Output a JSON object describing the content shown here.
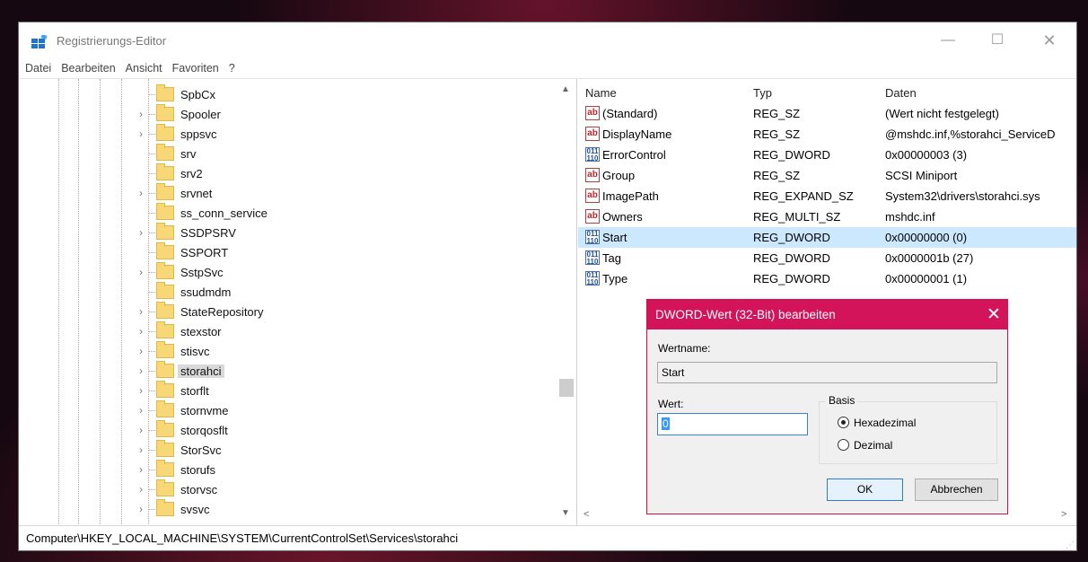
{
  "window": {
    "title": "Registrierungs-Editor",
    "minimize": "—",
    "maximize": "☐",
    "close": "✕"
  },
  "menu": [
    "Datei",
    "Bearbeiten",
    "Ansicht",
    "Favoriten",
    "?"
  ],
  "tree": {
    "items": [
      {
        "label": "SpbCx",
        "expandable": false
      },
      {
        "label": "Spooler",
        "expandable": true
      },
      {
        "label": "sppsvc",
        "expandable": true
      },
      {
        "label": "srv",
        "expandable": false
      },
      {
        "label": "srv2",
        "expandable": false
      },
      {
        "label": "srvnet",
        "expandable": true
      },
      {
        "label": "ss_conn_service",
        "expandable": false
      },
      {
        "label": "SSDPSRV",
        "expandable": true
      },
      {
        "label": "SSPORT",
        "expandable": false
      },
      {
        "label": "SstpSvc",
        "expandable": true
      },
      {
        "label": "ssudmdm",
        "expandable": false
      },
      {
        "label": "StateRepository",
        "expandable": true
      },
      {
        "label": "stexstor",
        "expandable": true
      },
      {
        "label": "stisvc",
        "expandable": true
      },
      {
        "label": "storahci",
        "expandable": true,
        "selected": true
      },
      {
        "label": "storflt",
        "expandable": true
      },
      {
        "label": "stornvme",
        "expandable": true
      },
      {
        "label": "storqosflt",
        "expandable": true
      },
      {
        "label": "StorSvc",
        "expandable": true
      },
      {
        "label": "storufs",
        "expandable": true
      },
      {
        "label": "storvsc",
        "expandable": true
      },
      {
        "label": "svsvc",
        "expandable": true
      }
    ]
  },
  "values": {
    "columns": {
      "name": "Name",
      "type": "Typ",
      "data": "Daten"
    },
    "rows": [
      {
        "icon": "string-value-icon",
        "name": "(Standard)",
        "type": "REG_SZ",
        "data": "(Wert nicht festgelegt)"
      },
      {
        "icon": "string-value-icon",
        "name": "DisplayName",
        "type": "REG_SZ",
        "data": "@mshdc.inf,%storahci_ServiceD"
      },
      {
        "icon": "binary-value-icon",
        "name": "ErrorControl",
        "type": "REG_DWORD",
        "data": "0x00000003 (3)"
      },
      {
        "icon": "string-value-icon",
        "name": "Group",
        "type": "REG_SZ",
        "data": "SCSI Miniport"
      },
      {
        "icon": "string-value-icon",
        "name": "ImagePath",
        "type": "REG_EXPAND_SZ",
        "data": "System32\\drivers\\storahci.sys"
      },
      {
        "icon": "string-value-icon",
        "name": "Owners",
        "type": "REG_MULTI_SZ",
        "data": "mshdc.inf"
      },
      {
        "icon": "binary-value-icon",
        "name": "Start",
        "type": "REG_DWORD",
        "data": "0x00000000 (0)",
        "highlight": true
      },
      {
        "icon": "binary-value-icon",
        "name": "Tag",
        "type": "REG_DWORD",
        "data": "0x0000001b (27)"
      },
      {
        "icon": "binary-value-icon",
        "name": "Type",
        "type": "REG_DWORD",
        "data": "0x00000001 (1)"
      }
    ]
  },
  "statusbar": {
    "path": "Computer\\HKEY_LOCAL_MACHINE\\SYSTEM\\CurrentControlSet\\Services\\storahci"
  },
  "dialog": {
    "title": "DWORD-Wert (32-Bit) bearbeiten",
    "close": "✕",
    "valuename_label": "Wertname:",
    "valuename": "Start",
    "value_label": "Wert:",
    "value": "0",
    "base_label": "Basis",
    "hex_label": "Hexadezimal",
    "dec_label": "Dezimal",
    "selected_base": "hex",
    "ok_label": "OK",
    "cancel_label": "Abbrechen"
  },
  "colors": {
    "dialog_accent": "#d4145a",
    "selection_highlight": "#cce8ff",
    "folder": "#f8d776"
  }
}
